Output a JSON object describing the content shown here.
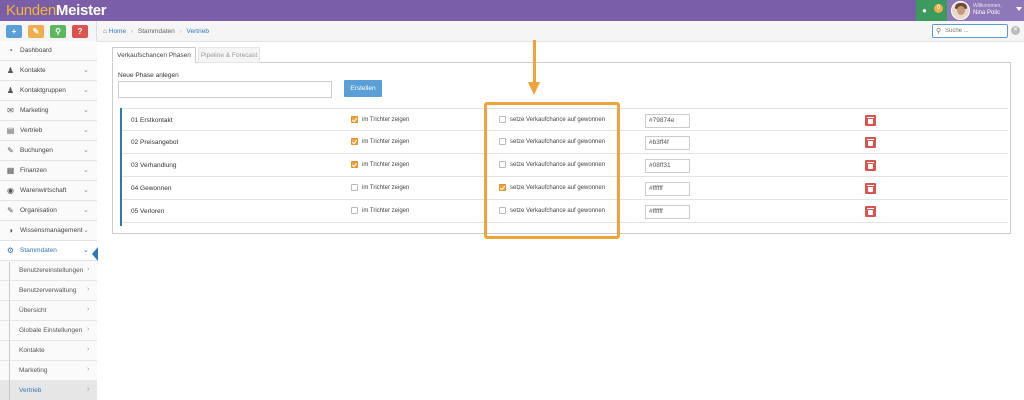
{
  "app": {
    "logo_part1": "Kunden",
    "logo_part2": "Meister",
    "chat_badge": "0",
    "welcome": "Willkommen,",
    "user_name": "Nina Polic"
  },
  "colors": {
    "topbar": "#7a5ea7",
    "accent": "#2e78b6",
    "highlight": "#f0a33a",
    "delete": "#d9534f"
  },
  "quick_buttons": [
    {
      "label": "+",
      "color": "#5a9fd6",
      "icon": "plus-icon"
    },
    {
      "label": "✎",
      "color": "#f0ad4e",
      "icon": "pen-icon"
    },
    {
      "label": "⚲",
      "color": "#5cb85c",
      "icon": "search-icon"
    },
    {
      "label": "?",
      "color": "#d9534f",
      "icon": "help-icon"
    }
  ],
  "sidebar": {
    "items": [
      {
        "label": "Dashboard",
        "icon": "dashboard-icon"
      },
      {
        "label": "Kontakte",
        "icon": "user-icon"
      },
      {
        "label": "Kontaktgruppen",
        "icon": "users-icon"
      },
      {
        "label": "Marketing",
        "icon": "envelope-icon"
      },
      {
        "label": "Vertrieb",
        "icon": "bar-chart-icon"
      },
      {
        "label": "Buchungen",
        "icon": "clipboard-icon"
      },
      {
        "label": "Finanzen",
        "icon": "money-icon"
      },
      {
        "label": "Warenwirtschaft",
        "icon": "globe-icon"
      },
      {
        "label": "Organisation",
        "icon": "edit-icon"
      },
      {
        "label": "Wissensmanagement",
        "icon": "half-circle-icon"
      },
      {
        "label": "Stammdaten",
        "icon": "cogs-icon"
      }
    ],
    "sub_items": [
      {
        "label": "Benutzereinstellungen"
      },
      {
        "label": "Benutzerverwaltung"
      },
      {
        "label": "Übersicht"
      },
      {
        "label": "Globale Einstellungen"
      },
      {
        "label": "Kontakte"
      },
      {
        "label": "Marketing"
      },
      {
        "label": "Vertrieb"
      }
    ]
  },
  "breadcrumb": {
    "home": "Home",
    "level1": "Stammdaten",
    "level2": "Vertrieb"
  },
  "search": {
    "placeholder": "Suche ..."
  },
  "tabs": {
    "active": "Verkaufschancen Phasen",
    "inactive": "Pipeline & Forecast"
  },
  "new_phase": {
    "label": "Neue Phase anlegen",
    "value": "",
    "button": "Erstellen"
  },
  "phases": [
    {
      "name": "01 Erstkontakt",
      "funnel_label": "im Trichter zeigen",
      "funnel_checked": true,
      "won_label": "setze Verkaufchance auf gewonnen",
      "won_checked": false,
      "color": "#79874e"
    },
    {
      "name": "02 Preisangebot",
      "funnel_label": "im Trichter zeigen",
      "funnel_checked": true,
      "won_label": "setze Verkaufchance auf gewonnen",
      "won_checked": false,
      "color": "#b3ff4f"
    },
    {
      "name": "03 Verhandlung",
      "funnel_label": "im Trichter zeigen",
      "funnel_checked": true,
      "won_label": "setze Verkaufchance auf gewonnen",
      "won_checked": false,
      "color": "#08ff31"
    },
    {
      "name": "04 Gewonnen",
      "funnel_label": "im Trichter zeigen",
      "funnel_checked": false,
      "won_label": "setze Verkaufchance auf gewonnen",
      "won_checked": true,
      "color": "#ffffff"
    },
    {
      "name": "05 Verloren",
      "funnel_label": "im Trichter zeigen",
      "funnel_checked": false,
      "won_label": "setze Verkaufchance auf gewonnen",
      "won_checked": false,
      "color": "#ffffff"
    }
  ]
}
